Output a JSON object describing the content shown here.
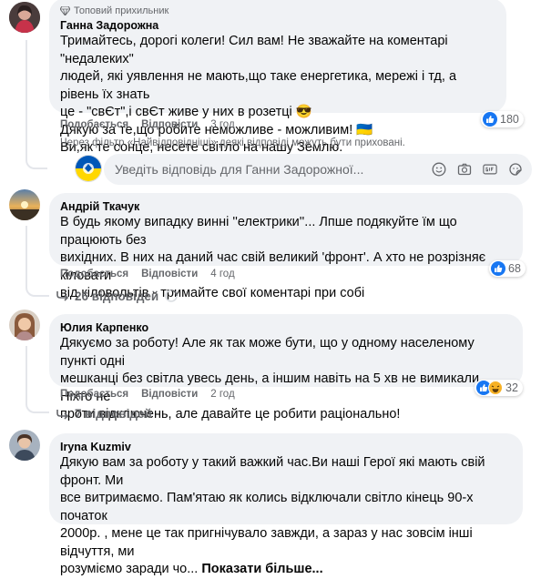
{
  "comments": [
    {
      "badge": "Топовий прихильник",
      "author": "Ганна Задорожна",
      "lines": [
        "Тримайтесь, дорогі колеги! Сил вам! Не зважайте на коментарі \"недалеких\"",
        "людей, які уявлення не мають,що таке енергетика, мережі і тд, а рівень їх знать",
        "це - \"свЄт\",і свЄт живе у них в розетці 😎",
        "Дякую за те,що робите неможливе - можливим! 🇺🇦",
        "Ви,як те сонце, несете світло на нашу Землю."
      ],
      "like": "Подобається",
      "reply": "Відповісти",
      "time": "3 год",
      "reactions": "180"
    },
    {
      "author": "Андрій Ткачук",
      "lines": [
        "В будь якому випадку винні ''електрики''... Лпше подякуйте їм що працюють без",
        "вихідних. В них на даний час свій великий 'фронт'. А хто не розрізняє кіловати",
        "від кіловольтів - тримайте свої коментарі при собі"
      ],
      "like": "Подобається",
      "reply": "Відповісти",
      "time": "4 год",
      "reactions": "68",
      "replies_label": "26 відповідей"
    },
    {
      "author": "Юлия Карпенко",
      "lines": [
        "Дякуємо за роботу! Але як так може бути, що у одному населеному пункті одні",
        "мешканці без світла увесь день, а іншим навіть на 5 хв не вимикали. Ніхто не",
        "проти відключень, але давайте це робити раціонально!"
      ],
      "like": "Подобається",
      "reply": "Відповісти",
      "time": "2 год",
      "reactions": "32",
      "replies_label": "7 відповідей"
    },
    {
      "author": "Iryna Kuzmiv",
      "lines": [
        "Дякую вам за роботу у такий важкий час.Ви наші Герої які мають свій фронт. Ми",
        "все витримаємо. Пам'ятаю як колись відключали світло кінець 90-х початок",
        "2000р. , мене це так пригнічувало завжди, а зараз у нас зовсім інші відчуття, ми",
        "розуміємо заради чо..."
      ],
      "see_more": "Показати більше..."
    }
  ],
  "filter_note": "Через фільтр «Найвідповідніші» деякі відповіді можуть бути приховані.",
  "reply_placeholder": "Уведіть відповідь для Ганни Задорожної...",
  "colors": {
    "like_blue": "#1877f2",
    "haha_yellow": "#f7b125",
    "bubble_bg": "#f0f2f5",
    "secondary_text": "#65676b"
  },
  "icons": [
    "gem-icon",
    "like-icon",
    "haha-icon",
    "emoji-icon",
    "camera-icon",
    "gif-icon",
    "sticker-icon",
    "reply-arrow-icon",
    "spinner-icon"
  ]
}
